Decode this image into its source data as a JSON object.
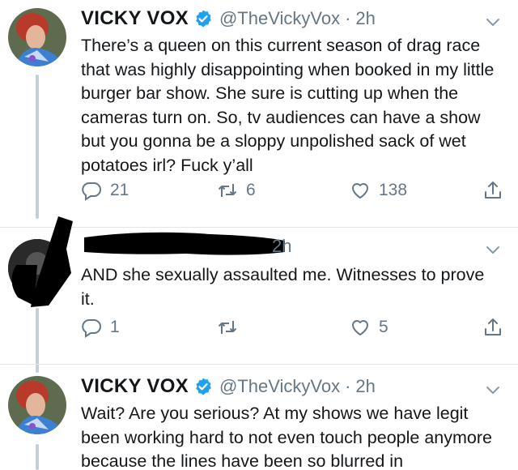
{
  "tweets": [
    {
      "name": "VICKY VOX",
      "handle": "@TheVickyVox",
      "separator": "·",
      "time": "2h",
      "text": "There’s a queen on this current season of drag race that was highly disappointing when booked in my little burger bar show. She sure is cutting up when the cameras turn on. So, tv audiences can have a show but you gonna be a sloppy unpolished sack of wet potatoes irl? Fuck y’all",
      "replies": "21",
      "retweets": "6",
      "likes": "138"
    },
    {
      "time": "2h",
      "text": "AND she sexually assaulted me. Witnesses to prove it.",
      "replies": "1",
      "retweets": "",
      "likes": "5"
    },
    {
      "name": "VICKY VOX",
      "handle": "@TheVickyVox",
      "separator": "·",
      "time": "2h",
      "text": "Wait? Are you serious? At my shows we have legit been working hard to not even touch people anymore because the lines have been so blurred in"
    }
  ],
  "icons": {
    "reply": "reply-icon",
    "retweet": "retweet-icon",
    "like": "heart-icon",
    "share": "share-icon",
    "verified": "verified-badge-icon",
    "caret": "chevron-down-icon"
  },
  "colors": {
    "text": "#14171a",
    "secondary": "#657786",
    "verified": "#1da1f2",
    "thread_line": "#c4cfd6"
  }
}
